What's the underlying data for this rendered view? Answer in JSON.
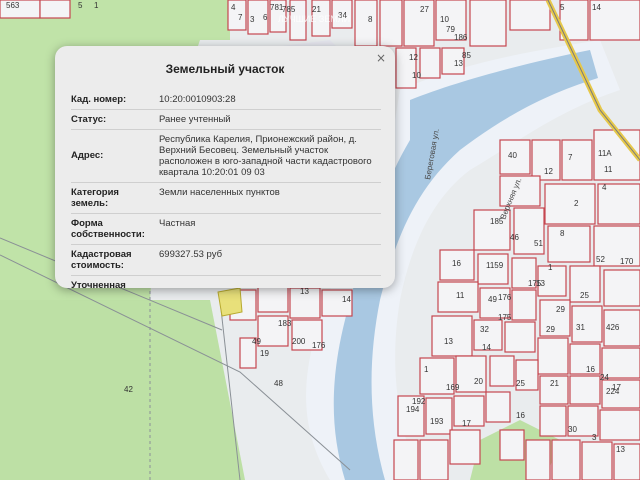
{
  "popup": {
    "title": "Земельный участок",
    "close_icon": "×",
    "rows": [
      {
        "label": "Кад. номер:",
        "value": "10:20:0010903:28"
      },
      {
        "label": "Статус:",
        "value": "Ранее учтенный"
      },
      {
        "label": "Адрес:",
        "value": "Республика Карелия, Прионежский район, д. Верхний Бесовец. Земельный участок расположен в юго-западной части кадастрового квартала 10:20:01 09 03"
      },
      {
        "label": "Категория земель:",
        "value": "Земли населенных пунктов"
      },
      {
        "label": "Форма собственности:",
        "value": "Частная"
      },
      {
        "label": "Кадастровая стоимость:",
        "value": "699327.53 руб"
      },
      {
        "label": "Уточненная",
        "value": ""
      }
    ]
  },
  "map": {
    "watermark": "ЛУЧШИЕ ЗЕМЛИ",
    "street_labels": [
      "Береговая ул.",
      "Верхняя ул."
    ],
    "parcel_numbers": [
      "563",
      "5",
      "1",
      "4",
      "7",
      "3",
      "6",
      "781",
      "785",
      "21",
      "34",
      "8",
      "27",
      "10",
      "79",
      "186",
      "85",
      "12",
      "13",
      "10",
      "5",
      "14",
      "11",
      "40",
      "7",
      "12",
      "11A",
      "185",
      "8",
      "4",
      "46",
      "2",
      "51",
      "1",
      "52",
      "170",
      "1159",
      "16",
      "49",
      "11",
      "176",
      "13",
      "175",
      "175",
      "29",
      "25",
      "29",
      "31",
      "426",
      "32",
      "13",
      "14",
      "183",
      "200",
      "13",
      "14",
      "176",
      "49",
      "19",
      "48",
      "20",
      "1",
      "25",
      "169",
      "24",
      "17",
      "16",
      "21",
      "224",
      "192",
      "194",
      "193",
      "16",
      "30",
      "3",
      "13",
      "17",
      "42"
    ],
    "colors": {
      "parcel_fill": "#f4f4f6",
      "parcel_stroke": "#c54650",
      "river": "#a9c8e2",
      "shore": "#eef2f7",
      "green": "#bfe2a6",
      "grid": "#9aa0a6",
      "road": "#e6c84a"
    }
  }
}
